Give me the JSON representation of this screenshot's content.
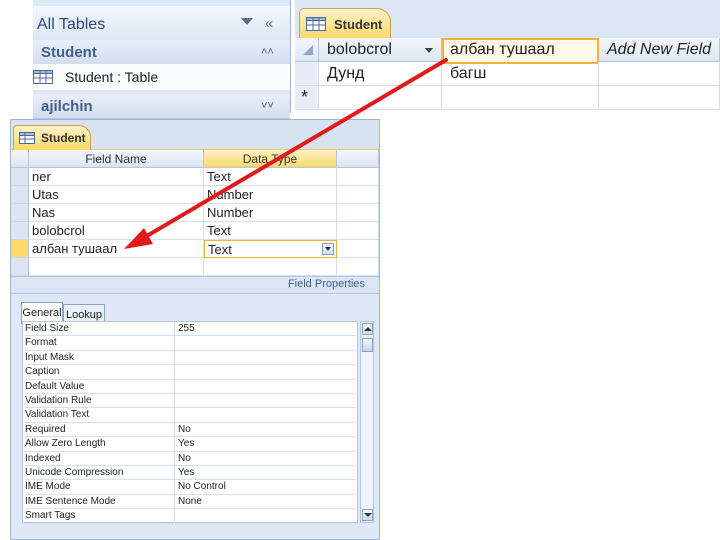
{
  "nav": {
    "all_tables": "All Tables",
    "groups": [
      {
        "label": "Student"
      },
      {
        "label": "ajilchin"
      }
    ],
    "items": [
      {
        "label": "Student : Table"
      }
    ]
  },
  "datasheet": {
    "tab": "Student",
    "columns": [
      "bolobcrol",
      "албан тушаал",
      "Add New Field"
    ],
    "rows": [
      [
        "Дунд",
        "багш",
        ""
      ]
    ],
    "new_row_marker": "*"
  },
  "design": {
    "tab": "Student",
    "headers": {
      "field_name": "Field Name",
      "data_type": "Data Type"
    },
    "fields": [
      {
        "name": "ner",
        "type": "Text"
      },
      {
        "name": "Utas",
        "type": "Number"
      },
      {
        "name": "Nas",
        "type": "Number"
      },
      {
        "name": "bolobcrol",
        "type": "Text"
      },
      {
        "name": "албан тушаал",
        "type": "Text"
      }
    ],
    "field_properties_label": "Field Properties",
    "tabs": [
      "General",
      "Lookup"
    ],
    "properties": [
      {
        "label": "Field Size",
        "value": "255"
      },
      {
        "label": "Format",
        "value": ""
      },
      {
        "label": "Input Mask",
        "value": ""
      },
      {
        "label": "Caption",
        "value": ""
      },
      {
        "label": "Default Value",
        "value": ""
      },
      {
        "label": "Validation Rule",
        "value": ""
      },
      {
        "label": "Validation Text",
        "value": ""
      },
      {
        "label": "Required",
        "value": "No"
      },
      {
        "label": "Allow Zero Length",
        "value": "Yes"
      },
      {
        "label": "Indexed",
        "value": "No"
      },
      {
        "label": "Unicode Compression",
        "value": "Yes"
      },
      {
        "label": "IME Mode",
        "value": "No Control"
      },
      {
        "label": "IME Sentence Mode",
        "value": "None"
      },
      {
        "label": "Smart Tags",
        "value": ""
      }
    ]
  },
  "colors": {
    "accent": "#f2b23b",
    "arrow": "#e11b1b",
    "panel": "#dfe8f6"
  }
}
